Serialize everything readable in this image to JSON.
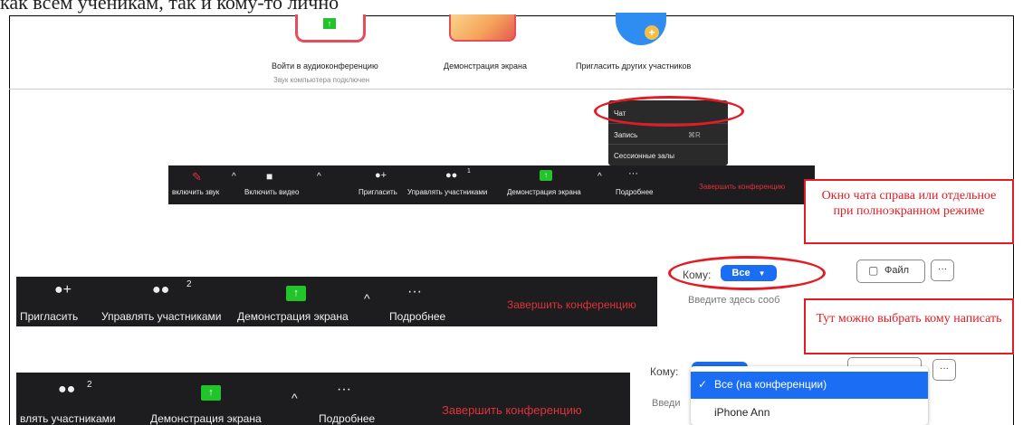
{
  "caption_top": "как всем ученикам, так и кому-то лично",
  "top_panel": {
    "join_audio": "Войти в аудиоконференцию",
    "audio_sub": "Звук компьютера подключен",
    "screen_share": "Демонстрация экрана",
    "invite_others": "Пригласить других участников"
  },
  "menu": {
    "chat": "Чат",
    "record": "Запись",
    "record_shortcut": "⌘R",
    "breakout": "Сессионные залы"
  },
  "toolbar1": {
    "mute": "включить звук",
    "video": "Включить видео",
    "invite": "Пригласить",
    "manage": "Управлять участниками",
    "participants_count": "1",
    "share": "Демонстрация экрана",
    "more": "Подробнее",
    "end": "Завершить конференцию"
  },
  "toolbar2": {
    "invite": "Пригласить",
    "manage": "Управлять участниками",
    "participants_count": "2",
    "share": "Демонстрация экрана",
    "more": "Подробнее",
    "end": "Завершить конференцию"
  },
  "toolbar3": {
    "manage": "влять участниками",
    "participants_count": "2",
    "share": "Демонстрация экрана",
    "more": "Подробнее",
    "end": "Завершить конференцию"
  },
  "callout1": "Окно чата справа или отдельное при полноэкранном режиме",
  "callout2": "Тут можно выбрать кому написать",
  "chat1": {
    "to_label": "Кому:",
    "to_value": "Все",
    "file_button": "Файл",
    "more_button": "···",
    "placeholder": "Введите здесь сооб"
  },
  "chat2": {
    "to_label": "Кому:",
    "placeholder": "Введи",
    "more_button": "···",
    "options": [
      "Все (на конференции)",
      "iPhone Ann"
    ]
  },
  "colors": {
    "accent_red": "#e31b23",
    "zoom_blue": "#1b6ef3",
    "share_green": "#22c42b",
    "toolbar_bg": "#1d1d1f"
  }
}
